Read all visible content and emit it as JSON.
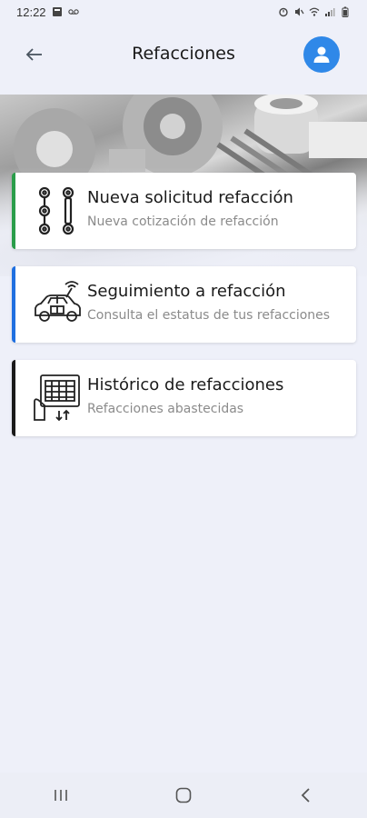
{
  "status_bar": {
    "time": "12:22"
  },
  "header": {
    "title": "Refacciones",
    "back_icon": "arrow-left-icon",
    "avatar_icon": "user-icon"
  },
  "cards": [
    {
      "title": "Nueva solicitud refacción",
      "subtitle": "Nueva cotización de refacción",
      "icon": "link-parts-icon",
      "accent": "#2a9d4a"
    },
    {
      "title": "Seguimiento a refacción",
      "subtitle": "Consulta el estatus de tus refacciones",
      "icon": "car-tracking-icon",
      "accent": "#1f6fe0"
    },
    {
      "title": "Histórico de refacciones",
      "subtitle": "Refacciones abastecidas",
      "icon": "history-list-icon",
      "accent": "#1a1a1a"
    }
  ],
  "colors": {
    "background": "#eef0f9",
    "avatar": "#2f88e8"
  },
  "nav_bar": {
    "buttons": [
      "recent-apps-icon",
      "home-icon",
      "back-icon"
    ]
  }
}
